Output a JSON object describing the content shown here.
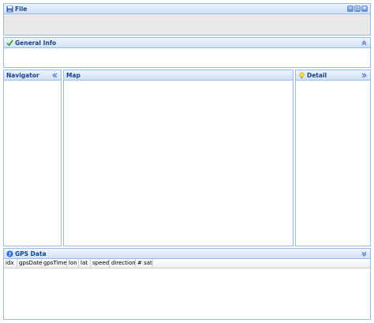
{
  "file_panel": {
    "title": "File",
    "icon": "floppy-disk-icon"
  },
  "general_panel": {
    "title": "General Info",
    "icon": "checkmark-icon"
  },
  "navigator_panel": {
    "title": "Navigator"
  },
  "map_panel": {
    "title": "Map"
  },
  "detail_panel": {
    "title": "Detail",
    "icon": "lightbulb-icon"
  },
  "gps_panel": {
    "title": "GPS Data",
    "icon": "help-icon",
    "columns": [
      "idx",
      "gpsDate",
      "gpsTime",
      "lon",
      "lat",
      "speed",
      "direction",
      "# sat"
    ]
  },
  "colors": {
    "border": "#99bbe8",
    "header_text": "#15428b",
    "file_body": "#e8e8e8"
  }
}
